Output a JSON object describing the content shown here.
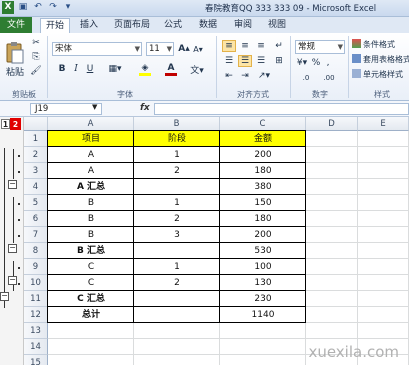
{
  "titlebar": {
    "title": "春院教育QQ 333 333 09 - Microsoft Excel"
  },
  "tabs": {
    "file": "文件",
    "items": [
      "开始",
      "插入",
      "页面布局",
      "公式",
      "数据",
      "审阅",
      "视图"
    ]
  },
  "ribbon": {
    "paste_label": "粘贴",
    "clipboard_label": "剪贴板",
    "font_name": "宋体",
    "font_size": "11",
    "font_group_label": "字体",
    "align_group_label": "对齐方式",
    "number_format": "常规",
    "number_group_label": "数字",
    "style_group_label": "样式",
    "style_items": [
      "条件格式",
      "套用表格格式",
      "单元格样式"
    ],
    "number_buttons": [
      "%",
      ",",
      ".0",
      ".00"
    ],
    "accent_color": "#2e7d32",
    "fill_color": "#ffff00",
    "font_color": "#c00000"
  },
  "formula_bar": {
    "name_box": "J19",
    "fx": "fx",
    "formula": ""
  },
  "outline": {
    "levels": [
      "1",
      "2"
    ],
    "selected_level": "2",
    "collapse_symbol": "−"
  },
  "sheet": {
    "columns": [
      "A",
      "B",
      "C",
      "D",
      "E"
    ],
    "rows": [
      "1",
      "2",
      "3",
      "4",
      "5",
      "6",
      "7",
      "8",
      "9",
      "10",
      "11",
      "12",
      "13",
      "14",
      "15"
    ],
    "header": [
      "项目",
      "阶段",
      "金额"
    ],
    "header_fill": "#ffff00",
    "data": [
      [
        "A",
        "1",
        "200"
      ],
      [
        "A",
        "2",
        "180"
      ],
      [
        "A 汇总",
        "",
        "380"
      ],
      [
        "B",
        "1",
        "150"
      ],
      [
        "B",
        "2",
        "180"
      ],
      [
        "B",
        "3",
        "200"
      ],
      [
        "B 汇总",
        "",
        "530"
      ],
      [
        "C",
        "1",
        "100"
      ],
      [
        "C",
        "2",
        "130"
      ],
      [
        "C 汇总",
        "",
        "230"
      ],
      [
        "总计",
        "",
        "1140"
      ]
    ]
  },
  "watermark": "xuexila.com"
}
